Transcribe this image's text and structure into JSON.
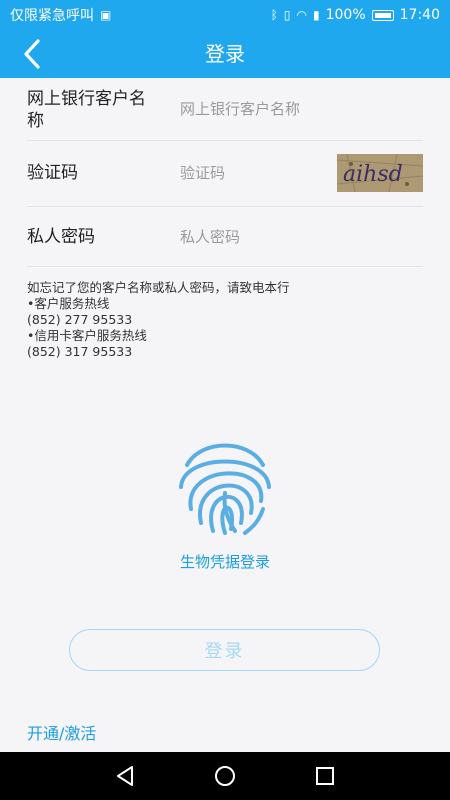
{
  "status_bar": {
    "carrier": "仅限紧急呼叫",
    "battery_percent": "100%",
    "time": "17:40"
  },
  "navbar": {
    "title": "登录"
  },
  "form": {
    "customer_name": {
      "label": "网上银行客户名称",
      "placeholder": "网上银行客户名称"
    },
    "captcha": {
      "label": "验证码",
      "placeholder": "验证码",
      "image_text": "aihsd"
    },
    "password": {
      "label": "私人密码",
      "placeholder": "私人密码"
    }
  },
  "hint": {
    "line1": "如忘记了您的客户名称或私人密码，请致电本行",
    "line2": "•客户服务热线",
    "line3": "(852) 277 95533",
    "line4": "•信用卡客户服务热线",
    "line5": "(852) 317 95533"
  },
  "biometric": {
    "label": "生物凭据登录"
  },
  "login_button": {
    "label": "登录"
  },
  "activate_link": {
    "label": "开通/激活"
  },
  "colors": {
    "primary": "#1fa8ee",
    "link": "#1d9ede",
    "button_disabled_text": "#a6d9f3"
  },
  "icons": [
    "back-arrow-icon",
    "fingerprint-icon",
    "sysnav-back-icon",
    "sysnav-home-icon",
    "sysnav-recents-icon"
  ]
}
